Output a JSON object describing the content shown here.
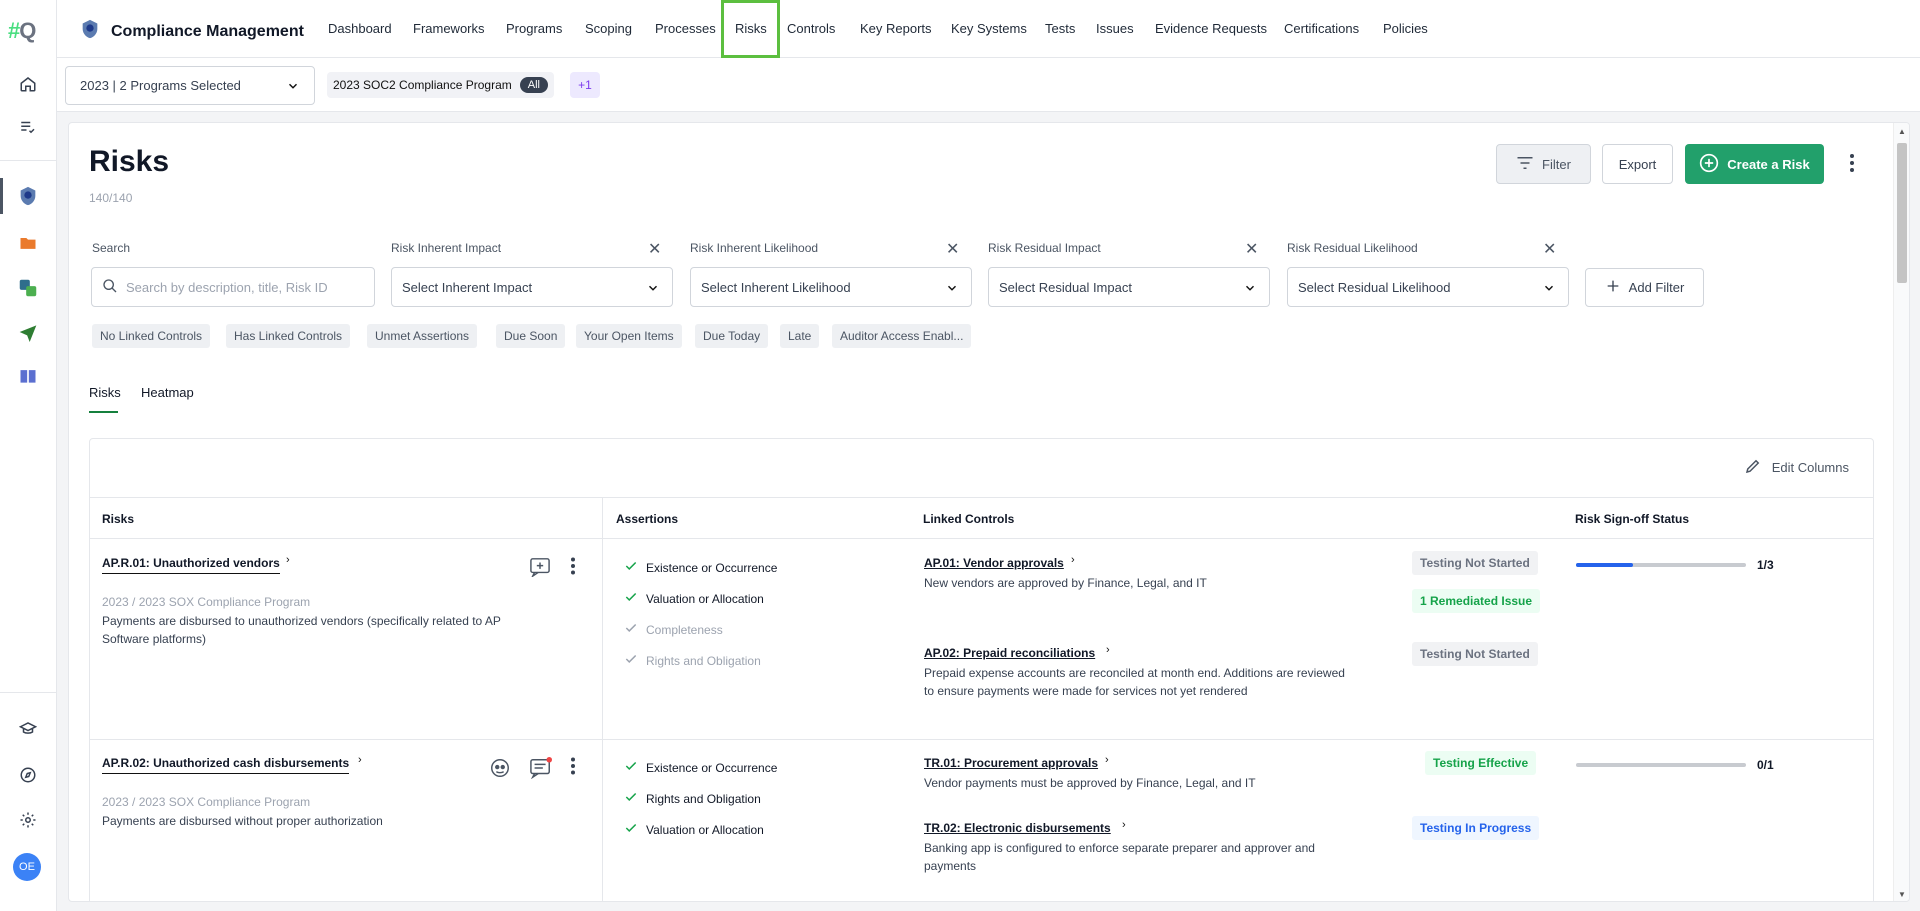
{
  "app": {
    "logo_hash": "#",
    "logo_letter": "Q",
    "title": "Compliance Management",
    "avatar_initials": "OE"
  },
  "nav": [
    "Dashboard",
    "Frameworks",
    "Programs",
    "Scoping",
    "Processes",
    "Risks",
    "Controls",
    "Key Reports",
    "Key Systems",
    "Tests",
    "Issues",
    "Evidence Requests",
    "Certifications",
    "Policies"
  ],
  "nav_active": "Risks",
  "program_bar": {
    "selector_value": "2023 | 2 Programs Selected",
    "chip_label": "2023 SOC2 Compliance Program",
    "chip_badge": "All",
    "more": "+1"
  },
  "page": {
    "title": "Risks",
    "count": "140/140"
  },
  "buttons": {
    "filter": "Filter",
    "export": "Export",
    "create": "Create a Risk",
    "add_filter": "Add Filter",
    "edit_columns": "Edit Columns"
  },
  "filters": {
    "search_label": "Search",
    "search_placeholder": "Search by description, title, Risk ID",
    "inherent_impact_label": "Risk Inherent Impact",
    "inherent_impact_placeholder": "Select Inherent Impact",
    "inherent_likelihood_label": "Risk Inherent Likelihood",
    "inherent_likelihood_placeholder": "Select Inherent Likelihood",
    "residual_impact_label": "Risk Residual Impact",
    "residual_impact_placeholder": "Select Residual Impact",
    "residual_likelihood_label": "Risk Residual Likelihood",
    "residual_likelihood_placeholder": "Select Residual Likelihood"
  },
  "quick_filters": [
    "No Linked Controls",
    "Has Linked Controls",
    "Unmet Assertions",
    "Due Soon",
    "Your Open Items",
    "Due Today",
    "Late",
    "Auditor Access Enabl..."
  ],
  "tabs": [
    "Risks",
    "Heatmap"
  ],
  "table": {
    "headers": [
      "Risks",
      "Assertions",
      "Linked Controls",
      "Risk Sign-off Status"
    ],
    "rows": [
      {
        "id_title": "AP.R.01: Unauthorized vendors",
        "program": "2023 / 2023 SOX Compliance Program",
        "description": "Payments are disbursed to unauthorized vendors (specifically related to AP Software platforms)",
        "assertions": [
          {
            "label": "Existence or Occurrence",
            "met": true
          },
          {
            "label": "Valuation or Allocation",
            "met": true
          },
          {
            "label": "Completeness",
            "met": false
          },
          {
            "label": "Rights and Obligation",
            "met": false
          }
        ],
        "controls": [
          {
            "title": "AP.01: Vendor approvals",
            "description": "New vendors are approved by Finance, Legal, and IT",
            "status": "Testing Not Started",
            "issue": "1 Remediated Issue"
          },
          {
            "title": "AP.02: Prepaid reconciliations",
            "description": "Prepaid expense accounts are reconciled at month end. Additions are reviewed to ensure payments were made for services not yet rendered",
            "status": "Testing Not Started"
          }
        ],
        "signoff": {
          "text": "1/3",
          "fraction": 0.333
        }
      },
      {
        "id_title": "AP.R.02: Unauthorized cash disbursements",
        "program": "2023 / 2023 SOX Compliance Program",
        "description": "Payments are disbursed without proper authorization",
        "assertions": [
          {
            "label": "Existence or Occurrence",
            "met": true
          },
          {
            "label": "Rights and Obligation",
            "met": true
          },
          {
            "label": "Valuation or Allocation",
            "met": true
          }
        ],
        "controls": [
          {
            "title": "TR.01: Procurement approvals",
            "description": "Vendor payments must be approved by Finance, Legal, and IT",
            "status": "Testing Effective"
          },
          {
            "title": "TR.02: Electronic disbursements",
            "description": "Banking app is configured to enforce separate preparer and approver and payments",
            "status": "Testing In Progress"
          }
        ],
        "signoff": {
          "text": "0/1",
          "fraction": 0
        }
      }
    ]
  },
  "colors": {
    "primary": "#22a06b",
    "nav_highlight": "#5cbf3f",
    "progress": "#2563eb",
    "effective": "#16a34a",
    "in_progress": "#2563eb"
  }
}
